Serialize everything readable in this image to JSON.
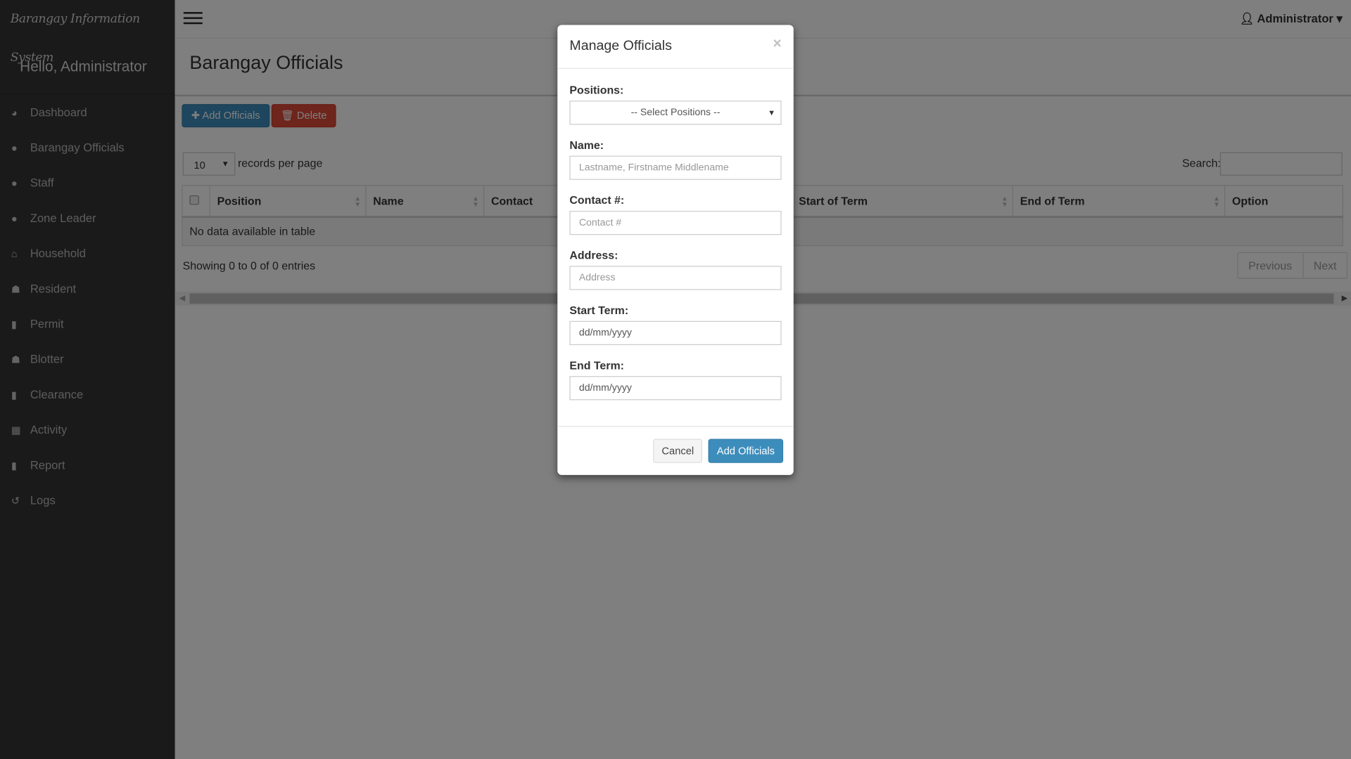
{
  "app": {
    "brand": "Barangay Information System",
    "greeting": "Hello, Administrator"
  },
  "sidebar": {
    "items": [
      {
        "label": "Dashboard",
        "icon": "dashboard-icon"
      },
      {
        "label": "Barangay Officials",
        "icon": "user-icon"
      },
      {
        "label": "Staff",
        "icon": "user-icon"
      },
      {
        "label": "Zone Leader",
        "icon": "user-icon"
      },
      {
        "label": "Household",
        "icon": "home-icon"
      },
      {
        "label": "Resident",
        "icon": "users-icon"
      },
      {
        "label": "Permit",
        "icon": "file-icon"
      },
      {
        "label": "Blotter",
        "icon": "users-icon"
      },
      {
        "label": "Clearance",
        "icon": "file-icon"
      },
      {
        "label": "Activity",
        "icon": "calendar-icon"
      },
      {
        "label": "Report",
        "icon": "file-icon"
      },
      {
        "label": "Logs",
        "icon": "history-icon"
      }
    ]
  },
  "header": {
    "user": "Administrator"
  },
  "page": {
    "title": "Barangay Officials",
    "add_button": "Add Officials",
    "delete_button": "Delete",
    "page_length": "10",
    "records_label": "records per page",
    "search_label": "Search:",
    "columns": [
      "Position",
      "Name",
      "Contact",
      "Start of Term",
      "End of Term",
      "Option"
    ],
    "empty_text": "No data available in table",
    "info": "Showing 0 to 0 of 0 entries",
    "previous": "Previous",
    "next": "Next"
  },
  "modal": {
    "title": "Manage Officials",
    "close": "×",
    "positions_label": "Positions:",
    "positions_value": "-- Select Positions --",
    "name_label": "Name:",
    "name_placeholder": "Lastname, Firstname Middlename",
    "contact_label": "Contact #:",
    "contact_placeholder": "Contact #",
    "address_label": "Address:",
    "address_placeholder": "Address",
    "start_label": "Start Term:",
    "start_value": "dd/mm/yyyy",
    "end_label": "End Term:",
    "end_value": "dd/mm/yyyy",
    "cancel": "Cancel",
    "submit": "Add Officials"
  },
  "colors": {
    "primary": "#3c8dbc",
    "danger": "#dd4b39",
    "sidebar": "#343434"
  }
}
